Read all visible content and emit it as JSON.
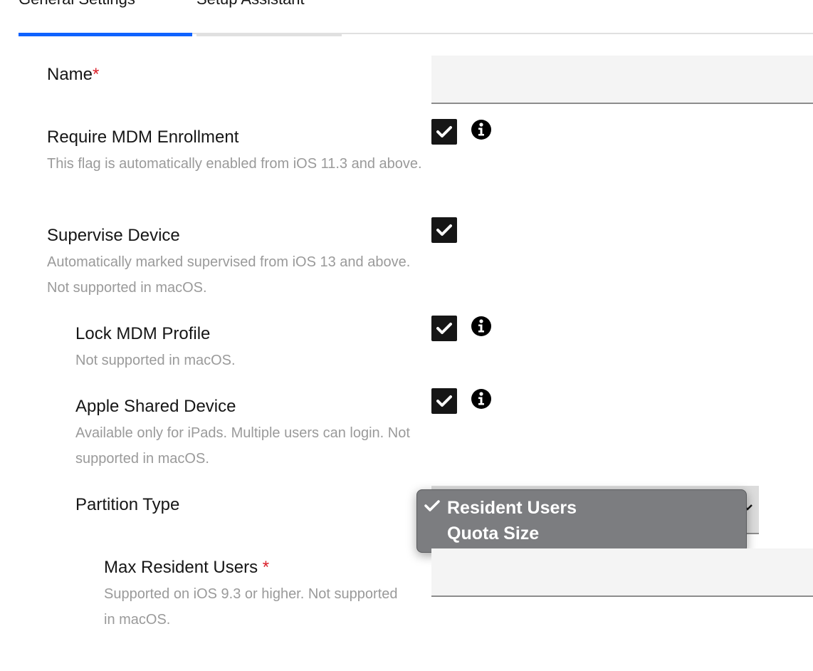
{
  "tabs": [
    {
      "label": "General Settings"
    },
    {
      "label": "Setup Assistant"
    }
  ],
  "form": {
    "name": {
      "label": "Name",
      "required_mark": "*",
      "value": ""
    },
    "require_mdm": {
      "label": "Require MDM Enrollment",
      "helper": "This flag is automatically enabled from iOS 11.3 and above.",
      "checked": true
    },
    "supervise": {
      "label": "Supervise Device",
      "helper": "Automatically marked supervised from iOS 13 and above. Not supported in macOS.",
      "checked": true
    },
    "lock_mdm": {
      "label": "Lock MDM Profile",
      "helper": "Not supported in macOS.",
      "checked": true
    },
    "shared_device": {
      "label": "Apple Shared Device",
      "helper": "Available only for iPads. Multiple users can login. Not supported in macOS.",
      "checked": true
    },
    "partition": {
      "label": "Partition Type",
      "selected": "Resident Users",
      "options": [
        "Resident Users",
        "Quota Size"
      ]
    },
    "max_resident": {
      "label": "Max Resident Users",
      "required_mark": "*",
      "helper": "Supported on iOS 9.3 or higher. Not supported in macOS.",
      "value": ""
    }
  },
  "icons": {
    "checkmark": "checkmark-icon",
    "info": "info-icon",
    "chevron": "chevron-down-icon"
  },
  "colors": {
    "tab_active": "#0f62fe",
    "required": "#da1e28",
    "checkbox": "#161616",
    "popup": "#7c7d80"
  }
}
